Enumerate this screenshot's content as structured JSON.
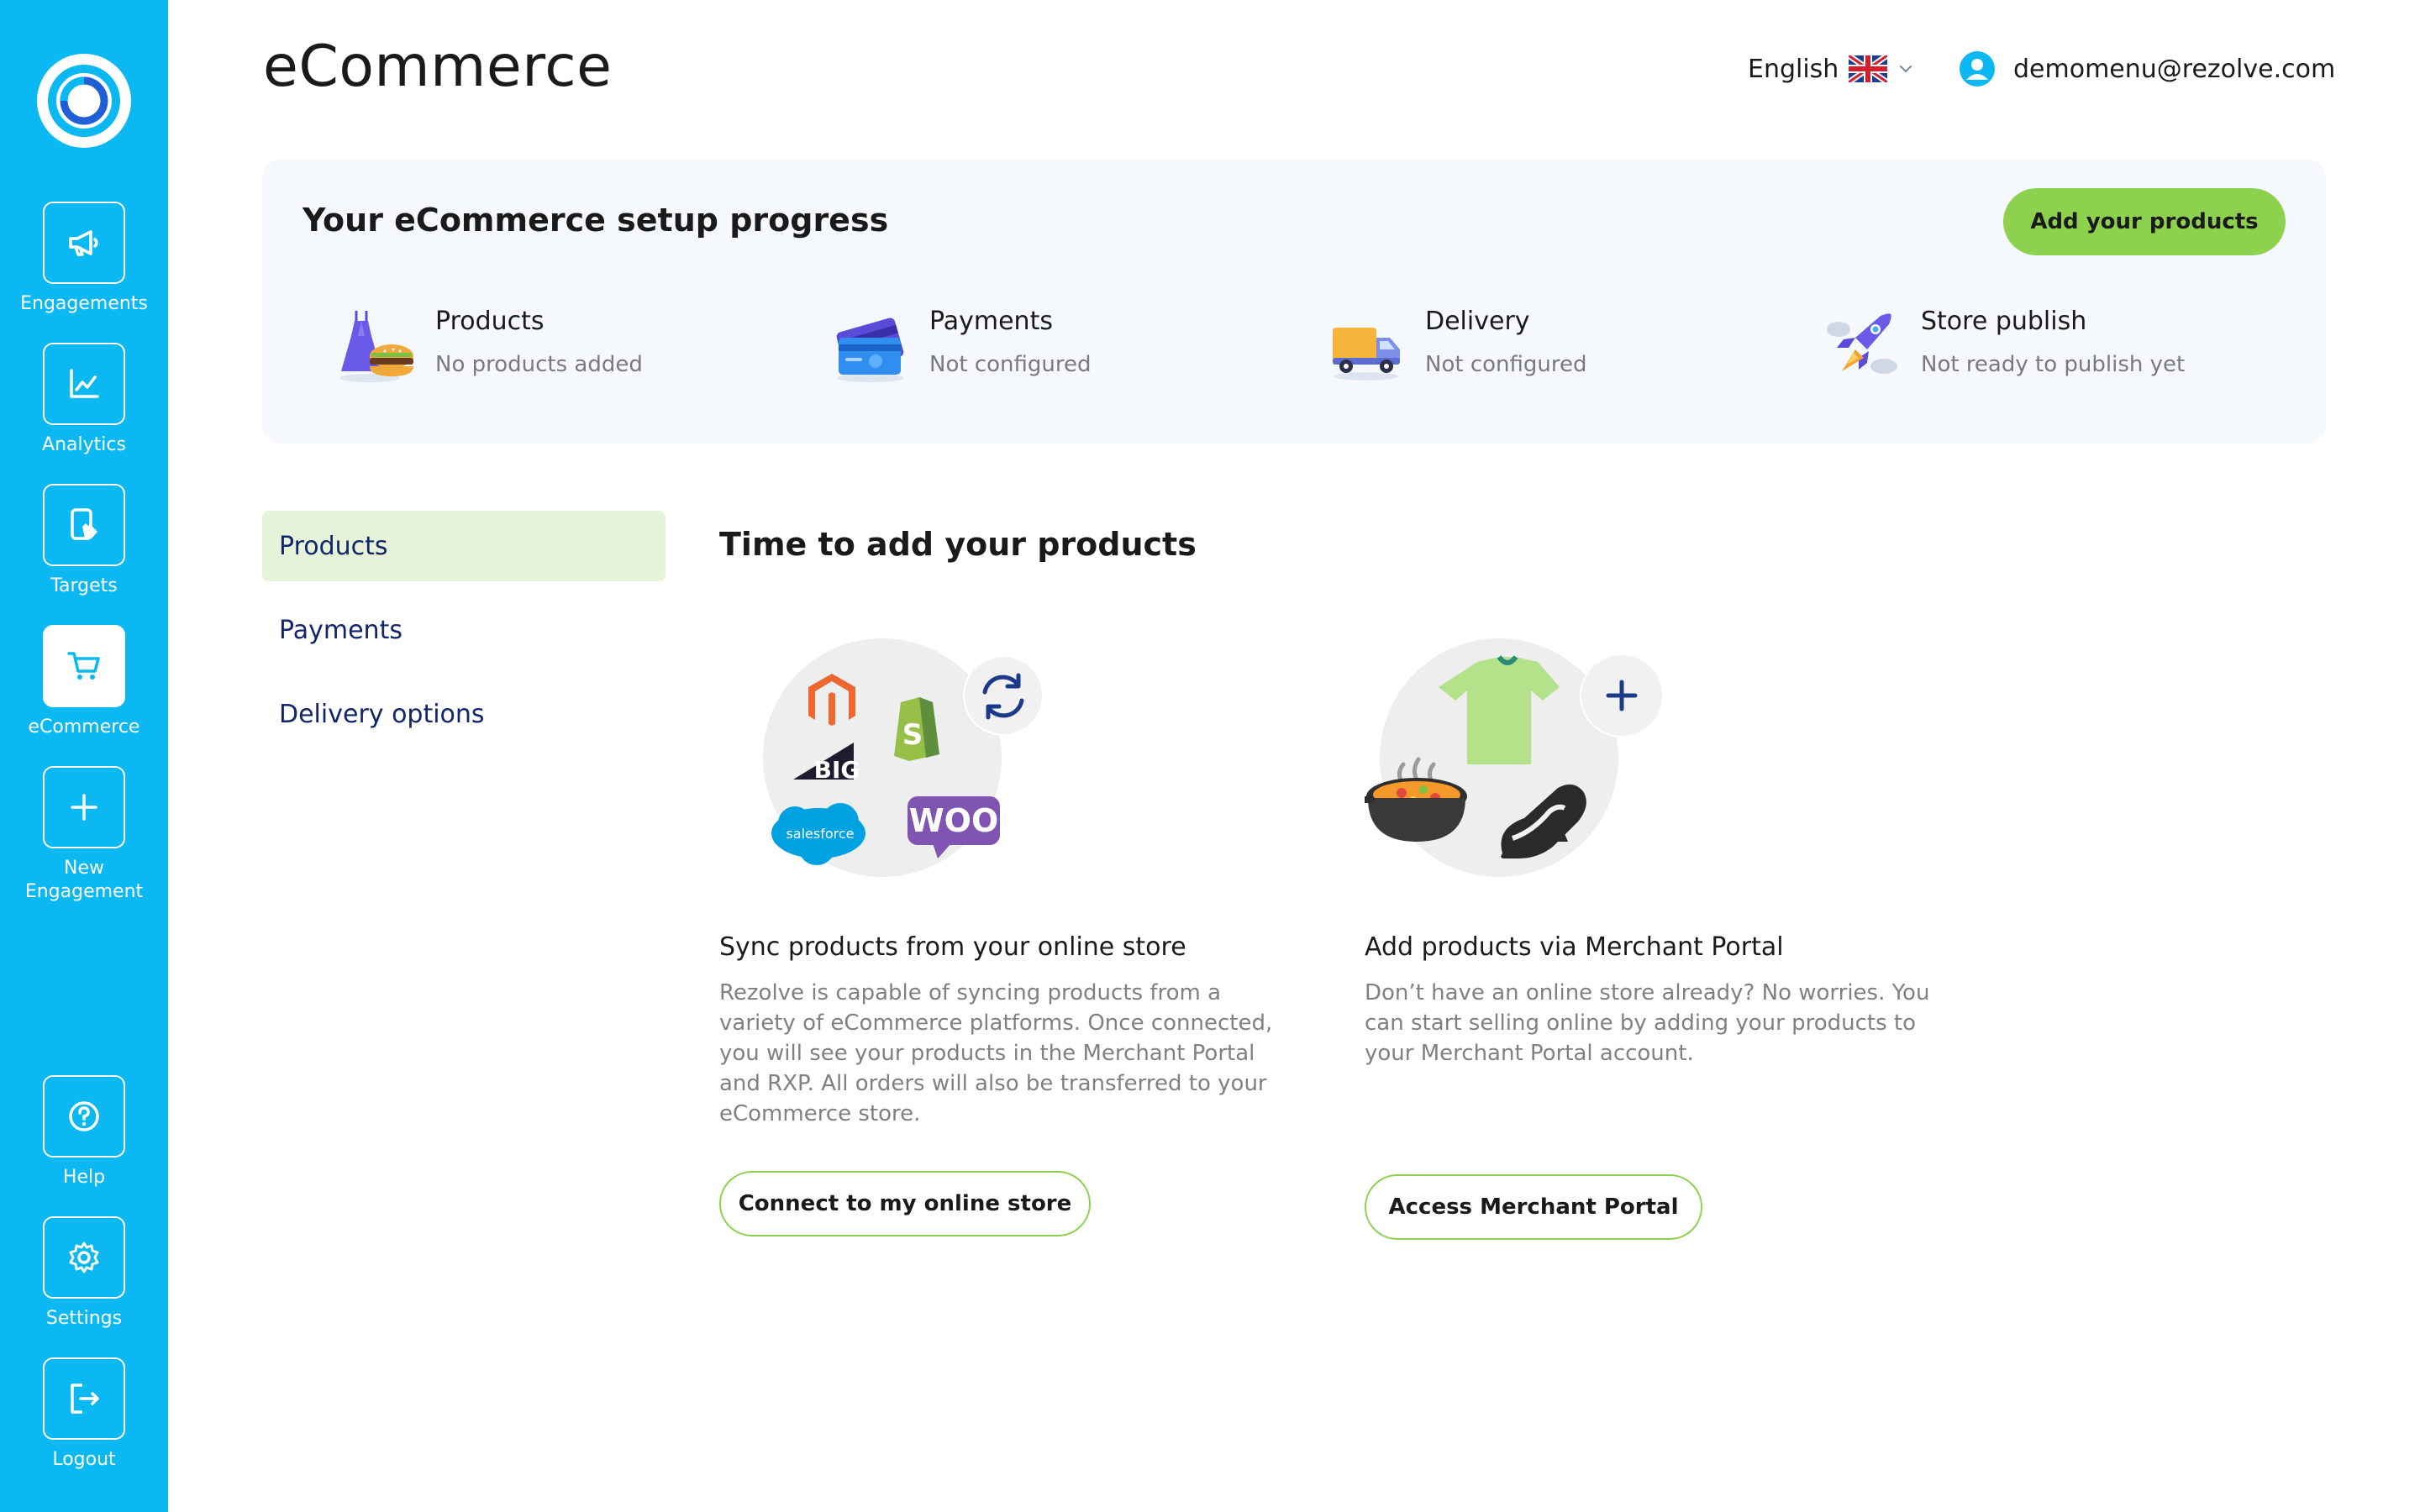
{
  "sidebar": {
    "logo_icon": "rezolve-logo",
    "items": [
      {
        "label": "Engagements",
        "icon": "megaphone-icon"
      },
      {
        "label": "Analytics",
        "icon": "line-chart-icon"
      },
      {
        "label": "Targets",
        "icon": "phone-tap-icon"
      },
      {
        "label": "eCommerce",
        "icon": "cart-icon",
        "active": true
      },
      {
        "label_line1": "New",
        "label_line2": "Engagement",
        "icon": "plus-icon"
      },
      {
        "label": "Help",
        "icon": "question-icon"
      },
      {
        "label": "Settings",
        "icon": "gear-icon"
      },
      {
        "label": "Logout",
        "icon": "logout-icon"
      }
    ]
  },
  "header": {
    "title": "eCommerce",
    "language": "English",
    "language_flag": "uk-flag-icon",
    "user_email": "demomenu@rezolve.com"
  },
  "progress": {
    "title": "Your eCommerce setup progress",
    "cta_label": "Add your products",
    "steps": [
      {
        "title": "Products",
        "status": "No products added",
        "icon": "dress-burger-icon"
      },
      {
        "title": "Payments",
        "status": "Not configured",
        "icon": "credit-card-icon"
      },
      {
        "title": "Delivery",
        "status": "Not configured",
        "icon": "truck-icon"
      },
      {
        "title": "Store publish",
        "status": "Not ready to publish yet",
        "icon": "rocket-icon"
      }
    ]
  },
  "subnav": {
    "items": [
      {
        "label": "Products",
        "active": true
      },
      {
        "label": "Payments"
      },
      {
        "label": "Delivery options"
      }
    ]
  },
  "main": {
    "section_title": "Time to add your products",
    "cards": [
      {
        "title": "Sync products from your online store",
        "description_lines": [
          "Rezolve is capable of syncing products from a",
          "variety of eCommerce platforms. Once connected,",
          "you will see your products in the Merchant Portal",
          "and RXP. All orders will also be transferred to your",
          "eCommerce store."
        ],
        "button_label": "Connect to my online store",
        "logo_text_big": "BIG",
        "logo_text_salesforce": "salesforce",
        "logo_text_woo": "WOO"
      },
      {
        "title": "Add products via Merchant Portal",
        "description_lines": [
          "Don’t have an online store already? No worries. You",
          "can start selling online by adding your products to",
          "your Merchant Portal account."
        ],
        "button_label": "Access Merchant Portal"
      }
    ]
  },
  "colors": {
    "sidebar": "#0bb8f1",
    "accent_green": "#8dd14f",
    "active_subnav": "#e6f3d9",
    "link_navy": "#10256b",
    "progress_bg": "#f5f8fc"
  }
}
